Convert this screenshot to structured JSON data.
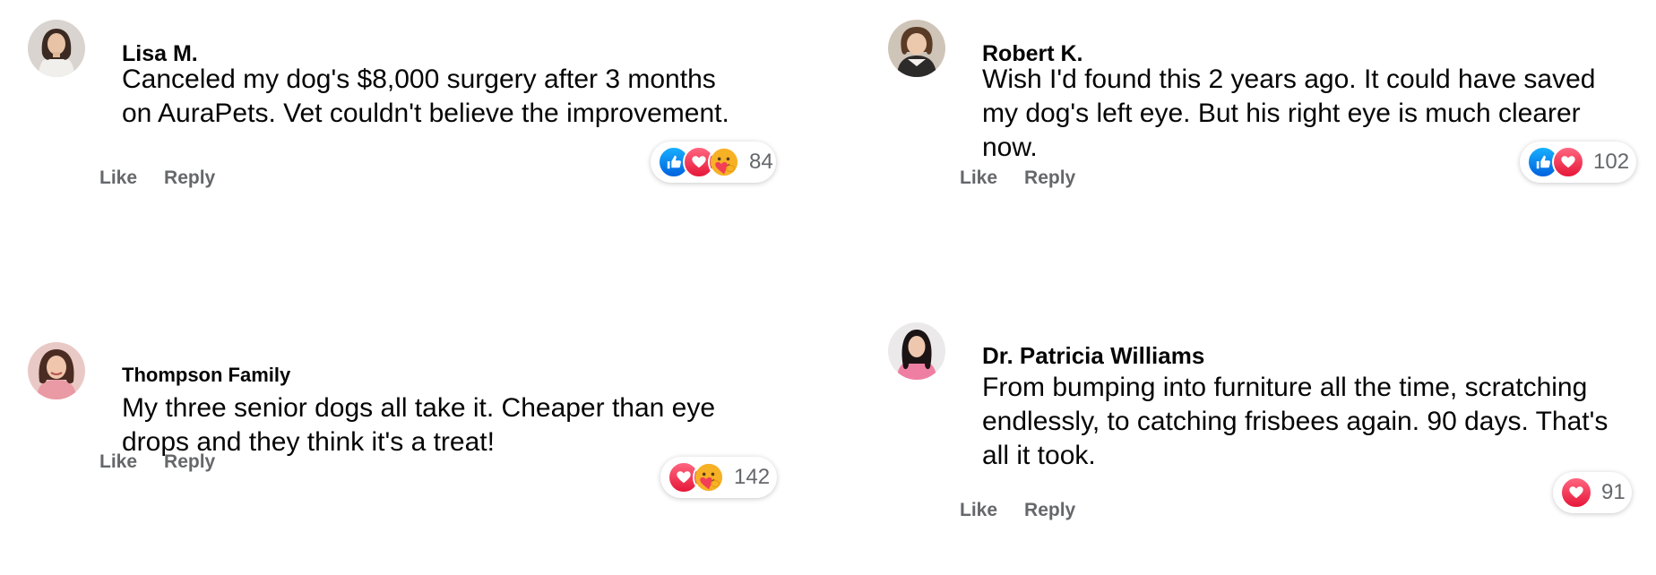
{
  "comments": [
    {
      "name": "Lisa M.",
      "text": "Canceled my dog's $8,000 surgery after 3 months on AuraPets. Vet couldn't believe the improvement.",
      "reactions": [
        "like",
        "love",
        "care"
      ],
      "reaction_count": "84",
      "like_label": "Like",
      "reply_label": "Reply"
    },
    {
      "name": "Robert K.",
      "text": "Wish I'd found this 2 years ago. It could have saved my dog's left eye. But his right eye is much clearer now.",
      "reactions": [
        "like",
        "love"
      ],
      "reaction_count": "102",
      "like_label": "Like",
      "reply_label": "Reply"
    },
    {
      "name": "Thompson Family",
      "text": "My three senior dogs all take it. Cheaper than eye drops and they think it's a treat!",
      "reactions": [
        "love",
        "care"
      ],
      "reaction_count": "142",
      "like_label": "Like",
      "reply_label": "Reply"
    },
    {
      "name": "Dr. Patricia Williams",
      "text": "From bumping into furniture all the time, scratching endlessly, to catching frisbees again. 90 days. That's all it took.",
      "reactions": [
        "love"
      ],
      "reaction_count": "91",
      "like_label": "Like",
      "reply_label": "Reply"
    }
  ],
  "colors": {
    "text": "#050505",
    "secondary": "#65676b",
    "like_blue": "#0866ff",
    "love_red": "#f33e58",
    "care_yellow": "#f7b125"
  }
}
